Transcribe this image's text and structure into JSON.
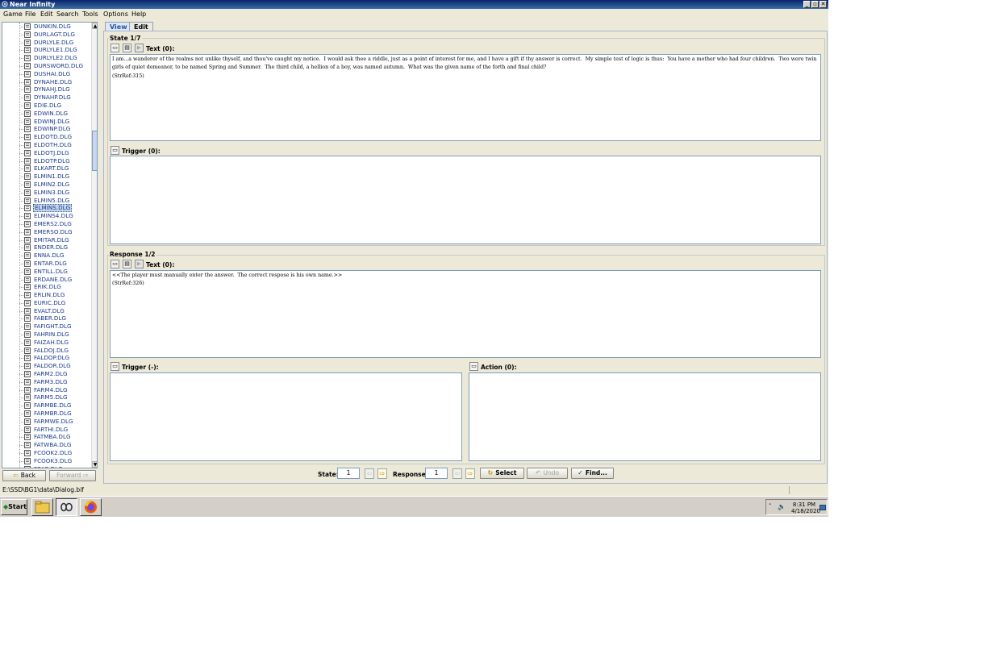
{
  "window": {
    "title": "Near Infinity",
    "buttons": [
      "_",
      "▫",
      "✕"
    ]
  },
  "menu": [
    "Game",
    "File",
    "Edit",
    "Search",
    "Tools",
    "Options",
    "Help"
  ],
  "tree": {
    "items": [
      "DUNKIN.DLG",
      "DURLAGT.DLG",
      "DURLYLE.DLG",
      "DURLYLE1.DLG",
      "DURLYLE2.DLG",
      "DURSWORD.DLG",
      "DUSHAI.DLG",
      "DYNAHE.DLG",
      "DYNAHJ.DLG",
      "DYNAHP.DLG",
      "EDIE.DLG",
      "EDWIN.DLG",
      "EDWINJ.DLG",
      "EDWINP.DLG",
      "ELDOTD.DLG",
      "ELDOTH.DLG",
      "ELDOTJ.DLG",
      "ELDOTP.DLG",
      "ELKART.DLG",
      "ELMIN1.DLG",
      "ELMIN2.DLG",
      "ELMIN3.DLG",
      "ELMIN5.DLG",
      "ELMINS.DLG",
      "ELMINS4.DLG",
      "EMERS2.DLG",
      "EMERSO.DLG",
      "EMITAR.DLG",
      "ENDER.DLG",
      "ENNA.DLG",
      "ENTAR.DLG",
      "ENTILL.DLG",
      "ERDANE.DLG",
      "ERIK.DLG",
      "ERLIN.DLG",
      "EURIC.DLG",
      "EVALT.DLG",
      "FABER.DLG",
      "FAFIGHT.DLG",
      "FAHRIN.DLG",
      "FAIZAH.DLG",
      "FALDOJ.DLG",
      "FALDOP.DLG",
      "FALDOR.DLG",
      "FARM2.DLG",
      "FARM3.DLG",
      "FARM4.DLG",
      "FARM5.DLG",
      "FARMBE.DLG",
      "FARMBR.DLG",
      "FARMWE.DLG",
      "FARTHI.DLG",
      "FATMBA.DLG",
      "FATWBA.DLG",
      "FCOOK2.DLG",
      "FCOOK3.DLG",
      "FEAR.DLG"
    ],
    "selected": "ELMINS.DLG"
  },
  "nav": {
    "back": "Back",
    "forward": "Forward"
  },
  "tabs": {
    "view": "View",
    "edit": "Edit"
  },
  "state": {
    "title": "State 1/7",
    "text_label": "Text (0):",
    "text": "I am...a wanderer of the realms not unlike thyself, and thou've caught my notice.  I would ask thee a riddle, just as a point of interest for me, and I have a gift if thy answer is correct.  My simple test of logic is thus:  You have a mother who had four children.  Two were twin girls of quiet demeanor, to be named Spring and Summer.  The third child, a hellion of a boy, was named autumn.  What was the given name of the forth and final child?\n(StrRef:315)",
    "trigger_label": "Trigger (0):",
    "trigger_text": ""
  },
  "response": {
    "title": "Response 1/2",
    "text_label": "Text (0):",
    "text": "<<The player must manually enter the answer.  The correct respose is his own name.>>\n(StrRef:326)",
    "trigger_label": "Trigger (-):",
    "action_label": "Action (0):"
  },
  "controls": {
    "state_label": "State:",
    "state_value": "1",
    "response_label": "Response:",
    "response_value": "1",
    "select": "Select",
    "undo": "Undo",
    "find": "Find..."
  },
  "status": "E:\\SSD\\BG1\\data\\Dialog.bif",
  "taskbar": {
    "start": "Start",
    "time": "8:31 PM",
    "date": "4/18/2020"
  }
}
